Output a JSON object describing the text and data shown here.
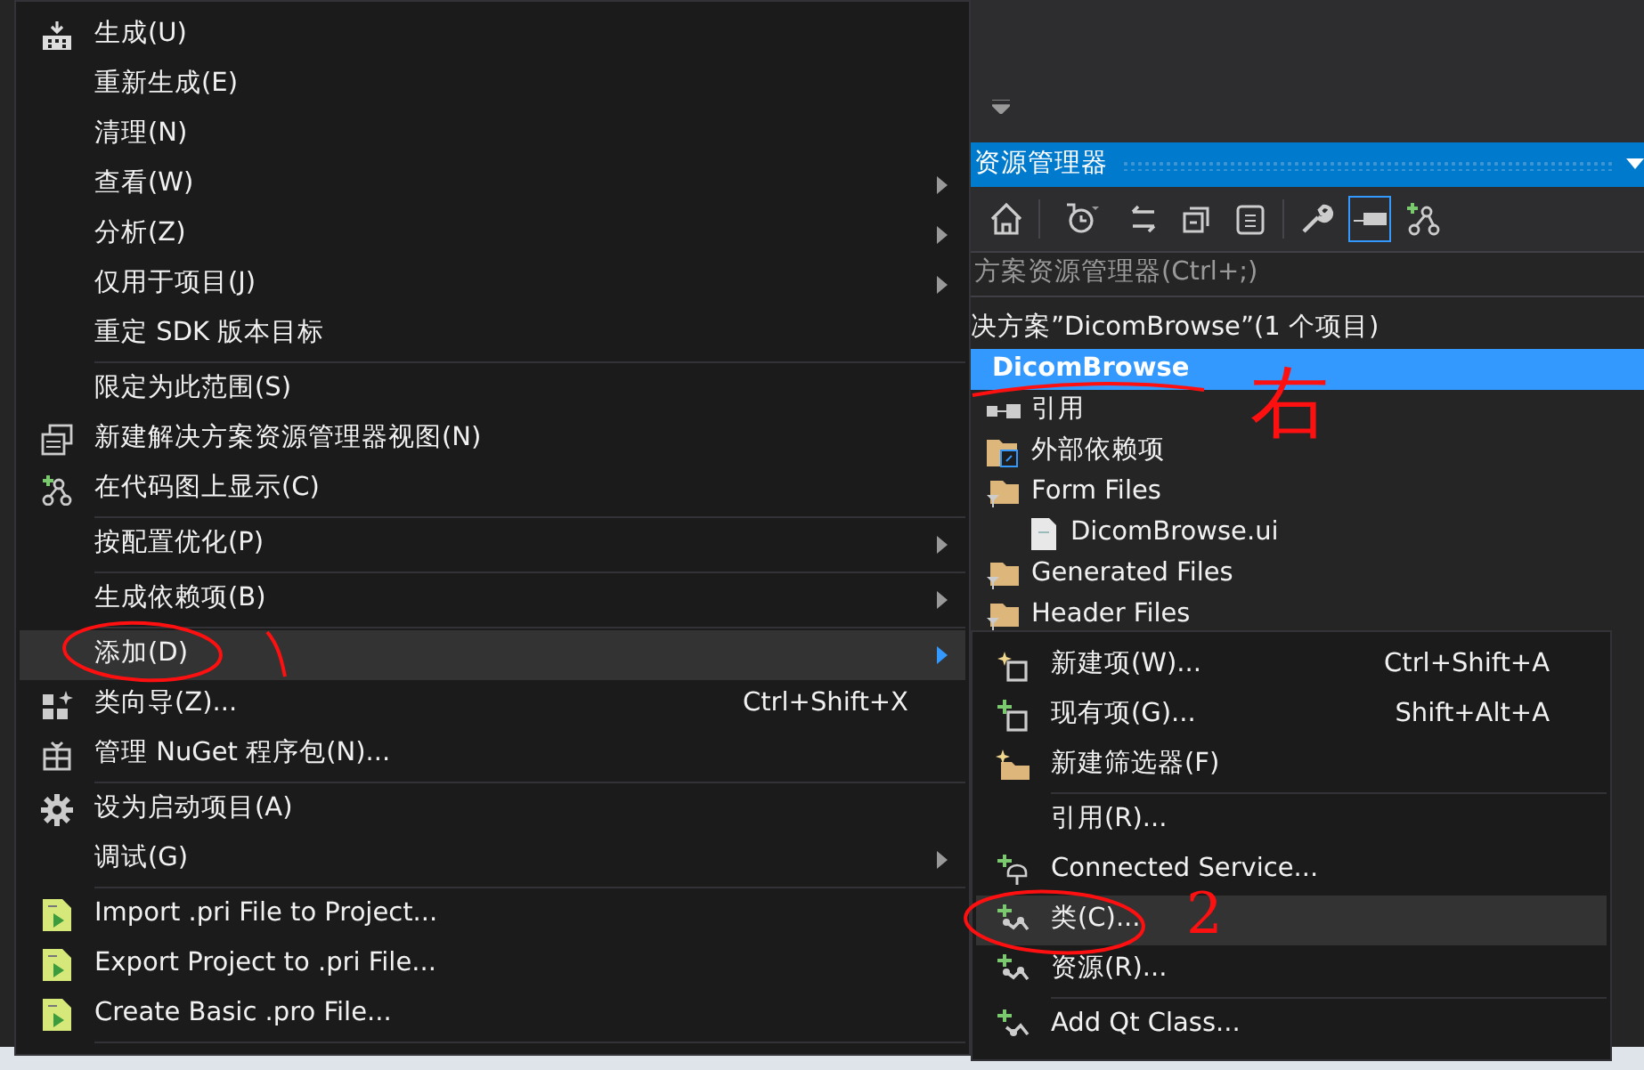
{
  "context_menu": {
    "items": [
      {
        "kind": "item",
        "label": "生成(U)",
        "submenu": false,
        "highlighted": false
      },
      {
        "kind": "item",
        "label": "重新生成(E)",
        "submenu": false,
        "highlighted": false
      },
      {
        "kind": "item",
        "label": "清理(N)",
        "submenu": false,
        "highlighted": false
      },
      {
        "kind": "item",
        "label": "查看(W)",
        "submenu": true,
        "highlighted": false
      },
      {
        "kind": "item",
        "label": "分析(Z)",
        "submenu": true,
        "highlighted": false
      },
      {
        "kind": "item",
        "label": "仅用于项目(J)",
        "submenu": true,
        "highlighted": false
      },
      {
        "kind": "item",
        "label": "重定 SDK 版本目标",
        "submenu": false,
        "highlighted": false
      },
      {
        "kind": "separator"
      },
      {
        "kind": "item",
        "label": "限定为此范围(S)",
        "submenu": false,
        "highlighted": false
      },
      {
        "kind": "item",
        "label": "新建解决方案资源管理器视图(N)",
        "submenu": false,
        "highlighted": false
      },
      {
        "kind": "item",
        "label": "在代码图上显示(C)",
        "submenu": false,
        "highlighted": false
      },
      {
        "kind": "separator"
      },
      {
        "kind": "item",
        "label": "按配置优化(P)",
        "submenu": true,
        "highlighted": false
      },
      {
        "kind": "separator"
      },
      {
        "kind": "item",
        "label": "生成依赖项(B)",
        "submenu": true,
        "highlighted": false
      },
      {
        "kind": "separator"
      },
      {
        "kind": "item",
        "label": "添加(D)",
        "submenu": true,
        "highlighted": true
      },
      {
        "kind": "item",
        "label": "类向导(Z)...",
        "shortcut": "Ctrl+Shift+X",
        "submenu": false,
        "highlighted": false
      },
      {
        "kind": "item",
        "label": "管理 NuGet 程序包(N)...",
        "submenu": false,
        "highlighted": false
      },
      {
        "kind": "separator"
      },
      {
        "kind": "item",
        "label": "设为启动项目(A)",
        "submenu": false,
        "highlighted": false
      },
      {
        "kind": "item",
        "label": "调试(G)",
        "submenu": true,
        "highlighted": false
      },
      {
        "kind": "separator"
      },
      {
        "kind": "item",
        "label": "Import .pri File to Project...",
        "submenu": false,
        "highlighted": false
      },
      {
        "kind": "item",
        "label": "Export Project to .pri File...",
        "submenu": false,
        "highlighted": false
      },
      {
        "kind": "item",
        "label": "Create Basic .pro File...",
        "submenu": false,
        "highlighted": false
      },
      {
        "kind": "separator"
      }
    ]
  },
  "add_submenu": {
    "items": [
      {
        "kind": "item",
        "label": "新建项(W)...",
        "shortcut": "Ctrl+Shift+A",
        "highlighted": false
      },
      {
        "kind": "item",
        "label": "现有项(G)...",
        "shortcut": "Shift+Alt+A",
        "highlighted": false
      },
      {
        "kind": "item",
        "label": "新建筛选器(F)",
        "highlighted": false
      },
      {
        "kind": "separator"
      },
      {
        "kind": "item",
        "label": "引用(R)...",
        "highlighted": false
      },
      {
        "kind": "item",
        "label": "Connected Service...",
        "highlighted": false
      },
      {
        "kind": "item",
        "label": "类(C)...",
        "highlighted": true
      },
      {
        "kind": "item",
        "label": "资源(R)...",
        "highlighted": false
      },
      {
        "kind": "separator"
      },
      {
        "kind": "item",
        "label": "Add Qt Class...",
        "highlighted": false
      }
    ]
  },
  "solution_explorer": {
    "title": "资源管理器",
    "toolbar": [
      {
        "selected": false
      },
      {
        "selected": false
      },
      {
        "selected": false
      },
      {
        "selected": false
      },
      {
        "selected": false
      },
      {
        "selected": false
      },
      {
        "selected": true
      },
      {
        "selected": false
      }
    ],
    "search": {
      "placeholder": "方案资源管理器(Ctrl+;)"
    },
    "tree": [
      {
        "label": "决方案”DicomBrowse”(1 个项目)",
        "selected": false,
        "children": [
          {
            "label": "DicomBrowse",
            "selected": true,
            "children": [
              {
                "kind": "references",
                "label": "引用",
                "selected": false
              },
              {
                "kind": "external",
                "label": "外部依赖项",
                "selected": false
              },
              {
                "kind": "filter",
                "label": "Form Files",
                "selected": false,
                "children": [
                  {
                    "kind": "file",
                    "label": "DicomBrowse.ui",
                    "selected": false
                  }
                ]
              },
              {
                "kind": "filter",
                "label": "Generated Files",
                "selected": false
              },
              {
                "kind": "filter",
                "label": "Header Files",
                "selected": false
              }
            ]
          }
        ]
      }
    ]
  },
  "annotations": [
    {
      "kind": "circle"
    },
    {
      "kind": "stroke"
    },
    {
      "kind": "underline"
    },
    {
      "kind": "text",
      "text": "右"
    },
    {
      "kind": "circle"
    },
    {
      "kind": "text",
      "text": "2"
    }
  ]
}
